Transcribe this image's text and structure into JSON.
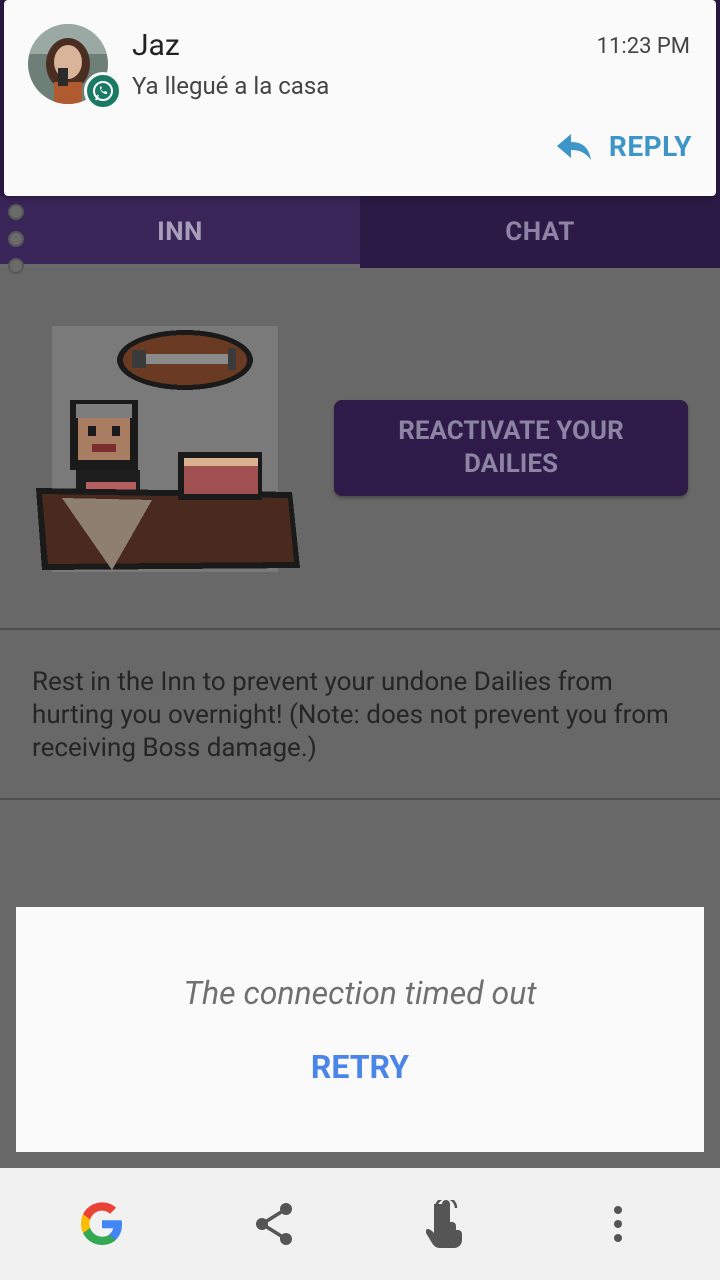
{
  "notification": {
    "sender": "Jaz",
    "message": "Ya llegué a la casa",
    "time": "11:23 PM",
    "reply_label": "REPLY",
    "app_badge_icon": "whatsapp-icon"
  },
  "tabs": [
    {
      "label": "INN",
      "active": true
    },
    {
      "label": "CHAT",
      "active": false
    }
  ],
  "inn": {
    "reactivate_label": "REACTIVATE YOUR DAILIES",
    "description": "Rest in the Inn to prevent your undone Dailies from hurting you overnight! (Note: does not prevent you from receiving Boss damage.)"
  },
  "dialog": {
    "message": "The connection timed out",
    "retry_label": "RETRY"
  },
  "bottom_bar": {
    "icons": [
      "google-icon",
      "share-icon",
      "touch-icon",
      "more-vert-icon"
    ]
  },
  "colors": {
    "accent_purple": "#2e1b4a",
    "reply_blue": "#3d95c8",
    "retry_blue": "#4a86e8",
    "whatsapp_green": "#1a7a63"
  }
}
